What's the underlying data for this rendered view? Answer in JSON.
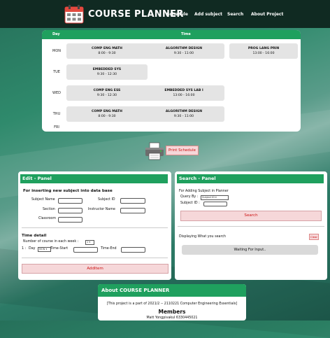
{
  "navbar": {
    "brand": "COURSE PLANNER",
    "links": [
      "Schedule",
      "Add subject",
      "Search",
      "About Project"
    ]
  },
  "schedule": {
    "headers": {
      "day": "Day",
      "time": "Time"
    },
    "days": [
      "MON",
      "TUE",
      "WED",
      "THU",
      "FRI"
    ],
    "courses": {
      "mon": [
        {
          "name": "COMP ENG MATH",
          "time": "8:00 - 9:30"
        },
        {
          "name": "ALGORITHM DESIGN",
          "time": "9:30 - 11:00"
        },
        {
          "name": "PROG LANG PRIN",
          "time": "13:00 - 16:00"
        }
      ],
      "tue": [
        {
          "name": "EMBEDDED SYS",
          "time": "9:30 - 12:30"
        }
      ],
      "wed": [
        {
          "name": "COMP ENG ESS",
          "time": "9:30 - 12:30"
        },
        {
          "name": "EMBEDDED SYS LAB I",
          "time": "13:00 - 16:00"
        }
      ],
      "thu": [
        {
          "name": "COMP ENG MATH",
          "time": "8:00 - 9:30"
        },
        {
          "name": "ALGORITHM DESIGN",
          "time": "9:30 - 11:00"
        }
      ]
    }
  },
  "print": {
    "label": "Print Schedule"
  },
  "edit_panel": {
    "title": "Edit - Panel",
    "section_title": "For inserting new subject into data base",
    "subject_name": "Subject Name",
    "subject_id": "Subject ID",
    "section": "Section",
    "instructor_name": "Instructor Name",
    "classroom": "Classroom",
    "time_detail": "Time detail",
    "count_label": "Number of course in each week :",
    "count_value": "1",
    "row_index": "1 :",
    "day_label": "Day",
    "day_value": "MON",
    "time_start": "Time-Start",
    "time_end": "Time-End",
    "add_button": "AddItem"
  },
  "search_panel": {
    "title": "Search - Panel",
    "desc": "For Adding Subject in Planner",
    "query_label": "Query By :",
    "query_value": "Subject ID",
    "subject_id": "Subject ID :",
    "search_button": "Search",
    "displaying": "Displaying What you search",
    "clear_button": "Clear",
    "status": "Waiting For Input.."
  },
  "about": {
    "title": "About COURSE PLANNER",
    "desc": "[This project is a part of 2021/2 -- 2110221 Computer Engineering Essentials]",
    "members_title": "Members",
    "member_1": "Matt Yongpivakul 6330445021"
  },
  "colors": {
    "accent": "#1fa05e",
    "navbar": "#102a22",
    "danger_bg": "#f6d7d9",
    "danger_text": "#cc1111"
  }
}
